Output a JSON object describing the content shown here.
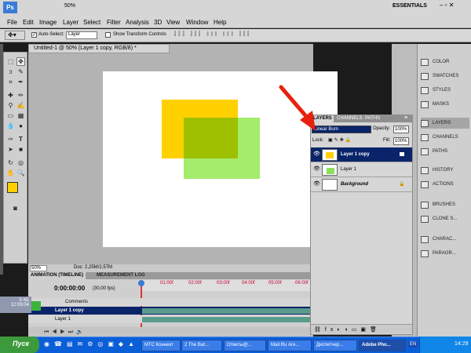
{
  "app": {
    "workspace": "ESSENTIALS",
    "zoom_menu": "50%",
    "menus": [
      "File",
      "Edit",
      "Image",
      "Layer",
      "Select",
      "Filter",
      "Analysis",
      "3D",
      "View",
      "Window",
      "Help"
    ]
  },
  "options_bar": {
    "auto_select_label": "Auto-Select:",
    "auto_select_value": "Layer",
    "show_transform_label": "Show Transform Controls"
  },
  "document": {
    "tab_title": "Untitled-1 @ 50% (Layer 1 copy, RGB/8) *",
    "zoom": "50%",
    "doc_info": "Doc: 2,25M/2,57M"
  },
  "timeline": {
    "tabs": [
      "ANIMATION (TIMELINE)",
      "MEASUREMENT LOG"
    ],
    "time": "0:00:00:00",
    "fps": "(30,00 fps)",
    "ruler": [
      "01:00f",
      "02:00f",
      "03:00f",
      "04:00f",
      "05:00f",
      "06:00f"
    ],
    "rows": [
      "Comments",
      "Layer 1 copy",
      "Layer 1"
    ]
  },
  "layers_panel": {
    "tabs": [
      "LAYERS",
      "CHANNELS",
      "PATHS"
    ],
    "blend_mode": "Linear Burn",
    "opacity_label": "Opacity:",
    "opacity_value": "100%",
    "lock_label": "Lock:",
    "fill_label": "Fill:",
    "fill_value": "100%",
    "layers": [
      "Layer 1 copy",
      "Layer 1",
      "Background"
    ]
  },
  "dock": {
    "items": [
      "COLOR",
      "SWATCHES",
      "STYLES",
      "MASKS",
      "LAYERS",
      "CHANNELS",
      "PATHS",
      "HISTORY",
      "ACTIONS",
      "BRUSHES",
      "CLONE S...",
      "CHARAC...",
      "PARAGR..."
    ]
  },
  "left_overlay": {
    "size": "5 КБ",
    "time": "12:09:04"
  },
  "taskbar": {
    "start": "Пуск",
    "items": [
      "МТС Коннект",
      "2 The Bat...",
      "Ответы@...",
      "Mail.Ru Аге...",
      "Диспетчер...",
      "Adobe Pho..."
    ],
    "lang": "EN",
    "clock": "14:29"
  },
  "colors": {
    "yellow": "#ffd000",
    "green": "#8ee05a",
    "overlap": "#9ec000",
    "selection": "#0a246a",
    "arrow": "#e8210e"
  }
}
